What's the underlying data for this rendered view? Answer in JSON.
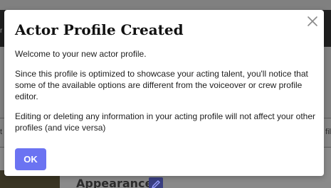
{
  "dialog": {
    "title": "Actor Profile Created",
    "paragraphs": [
      "Welcome to your new actor profile.",
      "Since this profile is optimized to showcase your acting talent, you'll notice that some of the available options are different from the voiceover or crew profile editor.",
      "Editing or deleting any information in your acting profile will not affect your other profiles (and vice versa)"
    ],
    "ok_label": "OK",
    "close_icon": "close-icon"
  },
  "background": {
    "section_title": "Appearance",
    "edit_icon": "pencil-icon",
    "left_tab_fragment": "t",
    "right_tab_fragment": "fil",
    "topbar_fragment": "r"
  },
  "colors": {
    "overlay": "#808080",
    "primary_button": "#6b73f2",
    "dialog_background": "#ffffff",
    "title_text": "#111111"
  }
}
